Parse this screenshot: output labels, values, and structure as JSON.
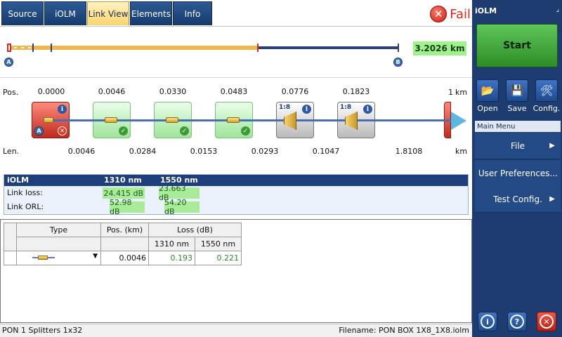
{
  "tabs": [
    {
      "label": "Source",
      "active": false
    },
    {
      "label": "iOLM",
      "active": false
    },
    {
      "label": "Link View",
      "active": true
    },
    {
      "label": "Elements",
      "active": false
    },
    {
      "label": "Info",
      "active": false
    }
  ],
  "status": {
    "label": "Fail",
    "color": "#e12a1b"
  },
  "overview": {
    "length": "3.2026 km",
    "point_a": "A",
    "point_b": "B"
  },
  "linkview": {
    "pos_label": "Pos.",
    "len_label": "Len.",
    "unit": "km",
    "positions": [
      "0.0000",
      "0.0046",
      "0.0330",
      "0.0483",
      "0.0776",
      "0.1823",
      "1"
    ],
    "lengths": [
      "0.0046",
      "0.0284",
      "0.0153",
      "0.0293",
      "0.1047",
      "1.8108"
    ],
    "splitter_ratio": "1:8",
    "point_a": "A"
  },
  "summary": {
    "headers": [
      "iOLM",
      "1310 nm",
      "1550 nm"
    ],
    "rows": [
      {
        "label": "Link loss:",
        "v1310": "24.415 dB",
        "v1550": "23.663 dB"
      },
      {
        "label": "Link ORL:",
        "v1310": "52.98 dB",
        "v1550": "54.20 dB"
      }
    ]
  },
  "events": {
    "headers": {
      "type": "Type",
      "pos": "Pos. (km)",
      "loss": "Loss (dB)",
      "w1310": "1310 nm",
      "w1550": "1550 nm"
    },
    "row": {
      "pos": "0.0046",
      "loss1310": "0.193",
      "loss1550": "0.221"
    }
  },
  "statusbar": {
    "left": "PON 1 Splitters 1x32",
    "right": "Filename: PON BOX 1X8_1X8.iolm"
  },
  "right_panel": {
    "title": "iOLM",
    "start": "Start",
    "tools": [
      {
        "label": "Open",
        "icon": "folder-open-icon"
      },
      {
        "label": "Save",
        "icon": "floppy-disk-icon"
      },
      {
        "label": "Config.",
        "icon": "tools-icon"
      }
    ],
    "menu_title": "Main Menu",
    "menu_items": [
      "File",
      "User Preferences...",
      "Test Config."
    ]
  },
  "colors": {
    "accent_blue": "#1e3c70",
    "success_green": "#9ff18b",
    "fail_red": "#e12a1b",
    "active_tab": "#f7d56d"
  }
}
